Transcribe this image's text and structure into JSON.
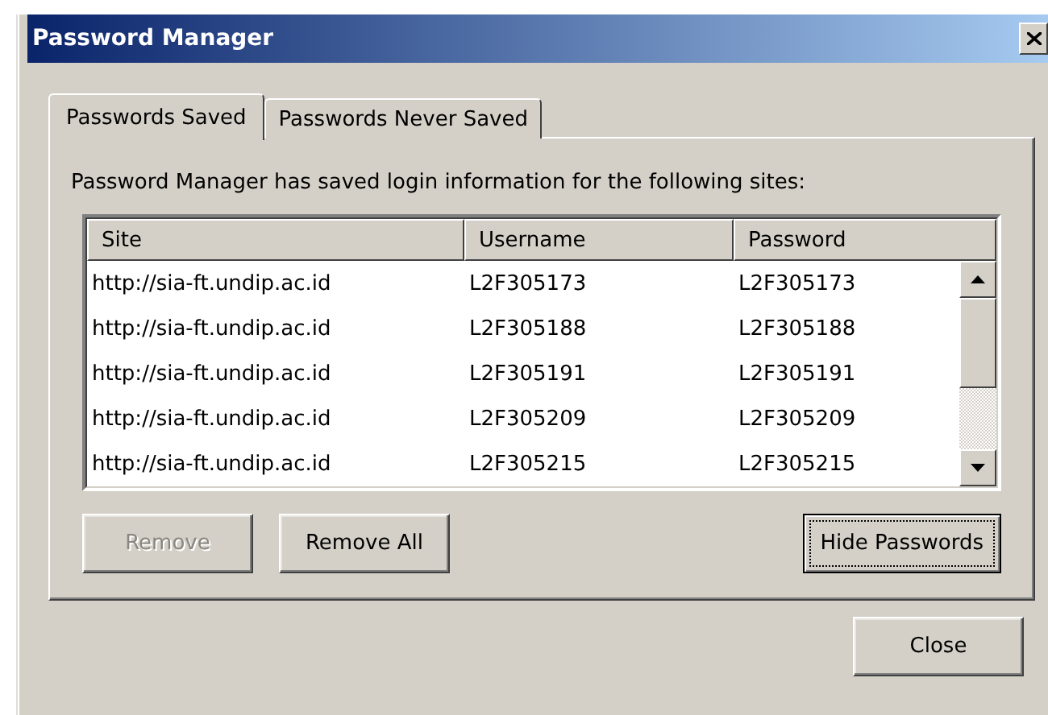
{
  "window": {
    "title": "Password Manager"
  },
  "tabs": [
    {
      "label": "Passwords Saved",
      "selected": true
    },
    {
      "label": "Passwords Never Saved",
      "selected": false
    }
  ],
  "description": "Password Manager has saved login information for the following sites:",
  "table": {
    "columns": [
      "Site",
      "Username",
      "Password"
    ],
    "rows": [
      {
        "site": "http://sia-ft.undip.ac.id",
        "username": "L2F305173",
        "password": "L2F305173"
      },
      {
        "site": "http://sia-ft.undip.ac.id",
        "username": "L2F305188",
        "password": "L2F305188"
      },
      {
        "site": "http://sia-ft.undip.ac.id",
        "username": "L2F305191",
        "password": "L2F305191"
      },
      {
        "site": "http://sia-ft.undip.ac.id",
        "username": "L2F305209",
        "password": "L2F305209"
      },
      {
        "site": "http://sia-ft.undip.ac.id",
        "username": "L2F305215",
        "password": "L2F305215"
      }
    ]
  },
  "buttons": [
    {
      "label": "Remove",
      "disabled": true,
      "focused": false
    },
    {
      "label": "Remove All",
      "disabled": false,
      "focused": false
    },
    {
      "label": "Hide Passwords",
      "disabled": false,
      "focused": true
    }
  ],
  "footer_buttons": [
    {
      "label": "Close",
      "disabled": false,
      "focused": false
    }
  ]
}
